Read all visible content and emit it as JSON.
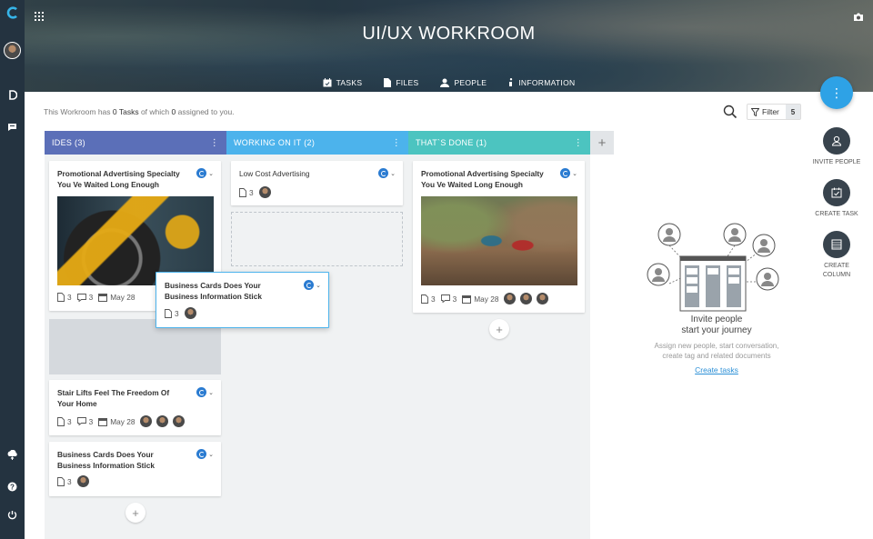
{
  "app": {
    "title": "UI/UX WORKROOM",
    "colors": {
      "rail": "#243340",
      "fab": "#2ea2e6",
      "col_ides": "#5b6fb8",
      "col_working": "#4cb3ec",
      "col_done": "#4cc4c0"
    }
  },
  "rail": {
    "logo_icon": "c-logo-icon",
    "items": [
      "d-icon",
      "chat-icon"
    ],
    "bottom": [
      "cloud-icon",
      "help-icon",
      "power-icon"
    ]
  },
  "header": {
    "tabs": [
      {
        "label": "TASKS",
        "icon": "calendar-icon"
      },
      {
        "label": "FILES",
        "icon": "file-icon"
      },
      {
        "label": "PEOPLE",
        "icon": "person-icon"
      },
      {
        "label": "INFORMATION",
        "icon": "info-icon"
      }
    ]
  },
  "summary": {
    "prefix": "This Workroom has",
    "tasks": "0 Tasks",
    "middle": "of which",
    "assigned": "0",
    "suffix": "assigned to you."
  },
  "filter": {
    "label": "Filter",
    "count": "5"
  },
  "columns": [
    {
      "title": "IDES",
      "count": "(3)"
    },
    {
      "title": "WORKING ON IT",
      "count": "(2)"
    },
    {
      "title": "THAT`S DONE",
      "count": "(1)"
    }
  ],
  "cards": {
    "c1": {
      "title": "Promotional Advertising Specialty You Ve Waited Long Enough",
      "files": "3",
      "comments": "3",
      "date": "May 28"
    },
    "c2": {
      "title": "Stair Lifts Feel The Freedom Of Your Home",
      "files": "3",
      "comments": "3",
      "date": "May 28"
    },
    "c3": {
      "title": "Business Cards Does Your Business Information Stick",
      "files": "3"
    },
    "w1": {
      "title": "Low Cost Advertising",
      "files": "3"
    },
    "drag": {
      "title": "Business Cards Does Your Business Information Stick",
      "files": "3"
    },
    "d1": {
      "title": "Promotional Advertising Specialty You Ve Waited Long Enough",
      "files": "3",
      "comments": "3",
      "date": "May 28"
    }
  },
  "actions": {
    "invite": "INVITE PEOPLE",
    "create_task": "CREATE TASK",
    "create_column_1": "CREATE",
    "create_column_2": "COLUMN"
  },
  "invite_panel": {
    "heading1": "Invite people",
    "heading2": "start your journey",
    "body": "Assign new people, start conversation, create tag and related documents",
    "link": "Create tasks"
  }
}
